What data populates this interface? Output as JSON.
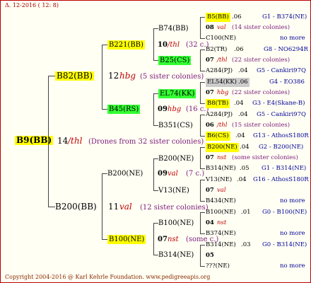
{
  "header": {
    "date": "Δ. 12-2016 ( 12:  8)"
  },
  "footer": {
    "copyright": "Copyright 2004-2016 @ Karl Kehrle Foundation.   www.pedigreeapis.org"
  },
  "root": {
    "name": "B9(BB)",
    "num": "14",
    "label": "/thl",
    "note": "(Drones from 32 sister colonies)"
  },
  "gen1": [
    {
      "name": "B82(BB)",
      "num": "12",
      "label": "hbg",
      "note": "(5 sister colonies)"
    },
    {
      "name": "B200(BB)",
      "num": "11",
      "label": "val",
      "note": "(12 sister colonies)"
    }
  ],
  "gen2": [
    {
      "name": "B221(BB)",
      "num": "10",
      "label": "/thl",
      "note": "(32 c.)"
    },
    {
      "name": "B45(RS)",
      "num": "09",
      "label": "hbg",
      "note": "(16 c.)"
    },
    {
      "name": "B200(NE)",
      "num": "09",
      "label": "val",
      "note": "(7 c.)"
    },
    {
      "name": "B100(NE)",
      "num": "07",
      "label": "nst",
      "note": "(some c.)"
    }
  ],
  "gen3": [
    {
      "name": "B74(BB)"
    },
    {
      "name": "B25(CS)"
    },
    {
      "name": "EL74(KK)"
    },
    {
      "name": "B351(CS)"
    },
    {
      "name": "B200(NE)"
    },
    {
      "name": "V13(NE)"
    },
    {
      "name": "B100(NE)"
    },
    {
      "name": "B314(NE)"
    }
  ],
  "gen4": [
    {
      "name": "B5(BB)",
      "year": ".06",
      "info": "G1 - B374(NE)"
    },
    {
      "num": "08",
      "label": "val",
      "note": "(14 sister colonies)"
    },
    {
      "name": "C100(NE)",
      "info": "no more"
    },
    {
      "name": "B2(TR)",
      "year": ".06",
      "info": "G8 - NO6294R"
    },
    {
      "num": "07",
      "label": "/thl",
      "note": "(22 sister colonies)"
    },
    {
      "name": "A284(PJ)",
      "year": ".04",
      "info": "G5 - Cankiri97Q"
    },
    {
      "name": "EL54(KK)",
      "year": ".06",
      "info": "G4 - EO386"
    },
    {
      "num": "07",
      "label": "hbg",
      "note": "(22 sister colonies)"
    },
    {
      "name": "B8(TB)",
      "year": ".04",
      "info": "G3 - E4(Skane-B)"
    },
    {
      "name": "A284(PJ)",
      "year": ".04",
      "info": "G5 - Cankiri97Q"
    },
    {
      "num": "06",
      "label": "/thl",
      "note": "(15 sister colonies)"
    },
    {
      "name": "B6(CS)",
      "year": ".04",
      "info": "G13 - AthosS180R"
    },
    {
      "name": "B200(NE)",
      "year": ".04",
      "info": "G2 - B200(NE)"
    },
    {
      "num": "07",
      "label": "nst",
      "note": "(some sister colonies)"
    },
    {
      "name": "B314(NE)",
      "year": ".05",
      "info": "G1 - B314(NE)"
    },
    {
      "name": "V13(NE)",
      "year": ".04",
      "info": "G16 - AthosS180R"
    },
    {
      "num": "07",
      "label": "val",
      "note": ""
    },
    {
      "name": "B434(NE)",
      "info": "no more"
    },
    {
      "name": "B100(NE)",
      "year": ".01",
      "info": "G0 - B100(NE)"
    },
    {
      "num": "04",
      "label": "nst",
      "note": ""
    },
    {
      "name": "B374(NE)",
      "info": "no more"
    },
    {
      "name": "B314(NE)",
      "year": ".03",
      "info": "G0 - B314(NE)"
    },
    {
      "num": "05",
      "label": "",
      "note": ""
    },
    {
      "name": "???(NE)",
      "info": "no more"
    }
  ]
}
